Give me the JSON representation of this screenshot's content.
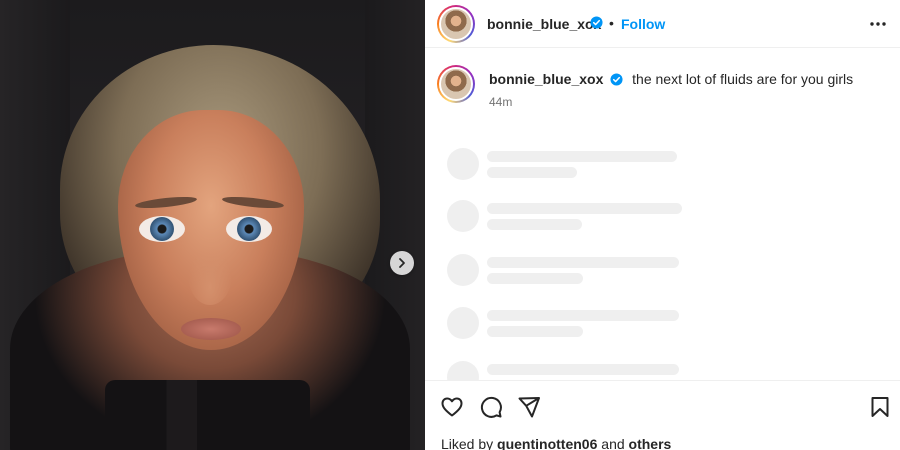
{
  "post": {
    "username": "bonnie_blue_xox",
    "follow_label": "Follow",
    "separator": "•",
    "caption": "the next lot of fluids are for you girls",
    "timestamp": "44m"
  },
  "likes": {
    "prefix": "Liked by",
    "user": "quentinotten06",
    "conjunction": "and",
    "others": "others"
  },
  "icons": {
    "verified": "verified-badge-icon",
    "more": "more-options-icon",
    "next": "chevron-right-icon",
    "like": "heart-icon",
    "comment": "comment-icon",
    "share": "paper-plane-icon",
    "save": "bookmark-icon"
  },
  "colors": {
    "follow_blue": "#0095f6",
    "verified_blue": "#0095f6",
    "skeleton": "#efefef",
    "text_secondary": "#737373"
  }
}
